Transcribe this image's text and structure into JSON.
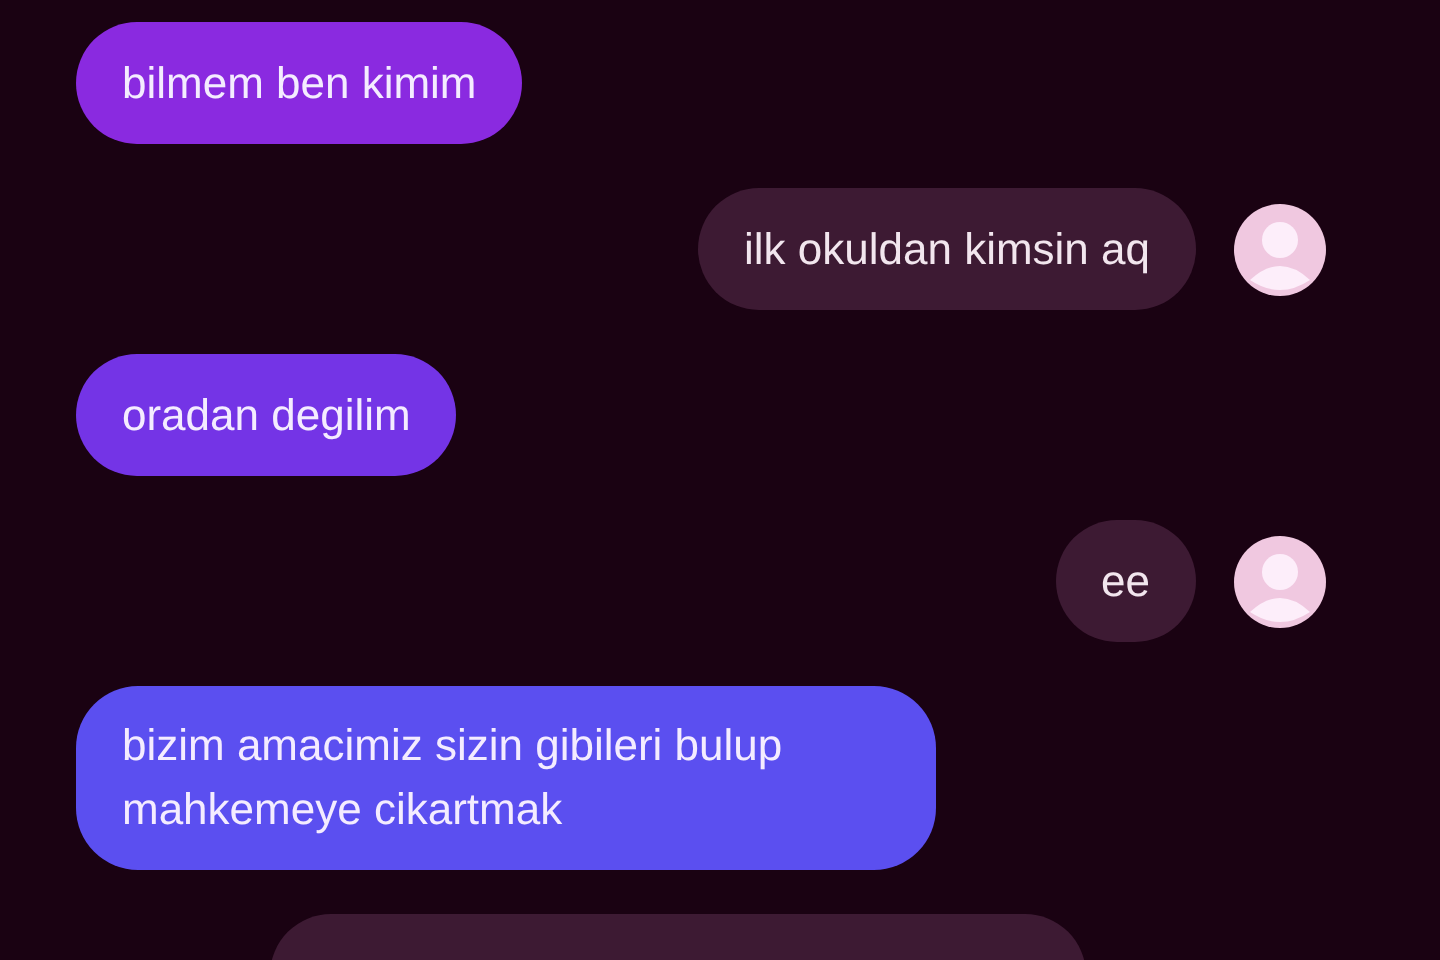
{
  "messages": [
    {
      "kind": "sent",
      "text": "bilmem ben kimim"
    },
    {
      "kind": "received",
      "text": "ilk okuldan kimsin aq"
    },
    {
      "kind": "sent",
      "text": "oradan degilim"
    },
    {
      "kind": "received",
      "text": "ee"
    },
    {
      "kind": "sent",
      "text": "bizim amacimiz sizin gibileri bulup mahkemeye cikartmak"
    },
    {
      "kind": "partial"
    }
  ]
}
